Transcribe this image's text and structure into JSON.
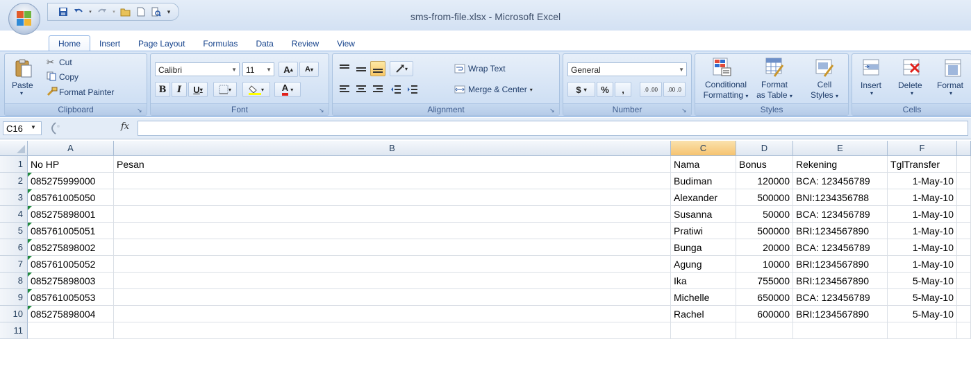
{
  "window": {
    "title": "sms-from-file.xlsx - Microsoft Excel",
    "quick_access": [
      "save-icon",
      "undo-icon",
      "redo-icon",
      "open-icon",
      "new-icon",
      "print-preview-icon",
      "customize-icon"
    ]
  },
  "tabs": [
    "Home",
    "Insert",
    "Page Layout",
    "Formulas",
    "Data",
    "Review",
    "View"
  ],
  "ribbon": {
    "clipboard": {
      "label": "Clipboard",
      "paste": "Paste",
      "cut": "Cut",
      "copy": "Copy",
      "format_painter": "Format Painter"
    },
    "font": {
      "label": "Font",
      "name": "Calibri",
      "size": "11",
      "bold": "B",
      "italic": "I",
      "underline": "U",
      "grow": "A",
      "shrink": "A",
      "font_color": "A"
    },
    "alignment": {
      "label": "Alignment",
      "wrap_text": "Wrap Text",
      "merge_center": "Merge & Center"
    },
    "number": {
      "label": "Number",
      "format": "General",
      "currency": "$",
      "percent": "%",
      "comma": ",",
      "inc_decimal": ".0 .00",
      "dec_decimal": ".00 .0"
    },
    "styles": {
      "label": "Styles",
      "cond_line1": "Conditional",
      "cond_line2": "Formatting",
      "table_line1": "Format",
      "table_line2": "as Table",
      "cell_line1": "Cell",
      "cell_line2": "Styles"
    },
    "cells": {
      "label": "Cells",
      "insert": "Insert",
      "delete": "Delete",
      "format": "Format"
    }
  },
  "formula_bar": {
    "name_box": "C16",
    "fx": "fx",
    "value": ""
  },
  "sheet": {
    "columns": [
      "A",
      "B",
      "C",
      "D",
      "E",
      "F"
    ],
    "rows": [
      {
        "n": "1",
        "a": "No HP",
        "b": "Pesan",
        "c": "Nama",
        "d": "Bonus",
        "e": "Rekening",
        "f": "TglTransfer"
      },
      {
        "n": "2",
        "a": "085275999000",
        "b": "",
        "c": "Budiman",
        "d": "120000",
        "e": "BCA: 123456789",
        "f": "1-May-10"
      },
      {
        "n": "3",
        "a": "085761005050",
        "b": "",
        "c": "Alexander",
        "d": "500000",
        "e": "BNI:1234356788",
        "f": "1-May-10"
      },
      {
        "n": "4",
        "a": "085275898001",
        "b": "",
        "c": "Susanna",
        "d": "50000",
        "e": "BCA: 123456789",
        "f": "1-May-10"
      },
      {
        "n": "5",
        "a": "085761005051",
        "b": "",
        "c": "Pratiwi",
        "d": "500000",
        "e": "BRI:1234567890",
        "f": "1-May-10"
      },
      {
        "n": "6",
        "a": "085275898002",
        "b": "",
        "c": "Bunga",
        "d": "20000",
        "e": "BCA: 123456789",
        "f": "1-May-10"
      },
      {
        "n": "7",
        "a": "085761005052",
        "b": "",
        "c": "Agung",
        "d": "10000",
        "e": "BRI:1234567890",
        "f": "1-May-10"
      },
      {
        "n": "8",
        "a": "085275898003",
        "b": "",
        "c": "Ika",
        "d": "755000",
        "e": "BRI:1234567890",
        "f": "5-May-10"
      },
      {
        "n": "9",
        "a": "085761005053",
        "b": "",
        "c": "Michelle",
        "d": "650000",
        "e": "BCA: 123456789",
        "f": "5-May-10"
      },
      {
        "n": "10",
        "a": "085275898004",
        "b": "",
        "c": "Rachel",
        "d": "600000",
        "e": "BRI:1234567890",
        "f": "5-May-10"
      },
      {
        "n": "11",
        "a": "",
        "b": "",
        "c": "",
        "d": "",
        "e": "",
        "f": ""
      }
    ]
  }
}
